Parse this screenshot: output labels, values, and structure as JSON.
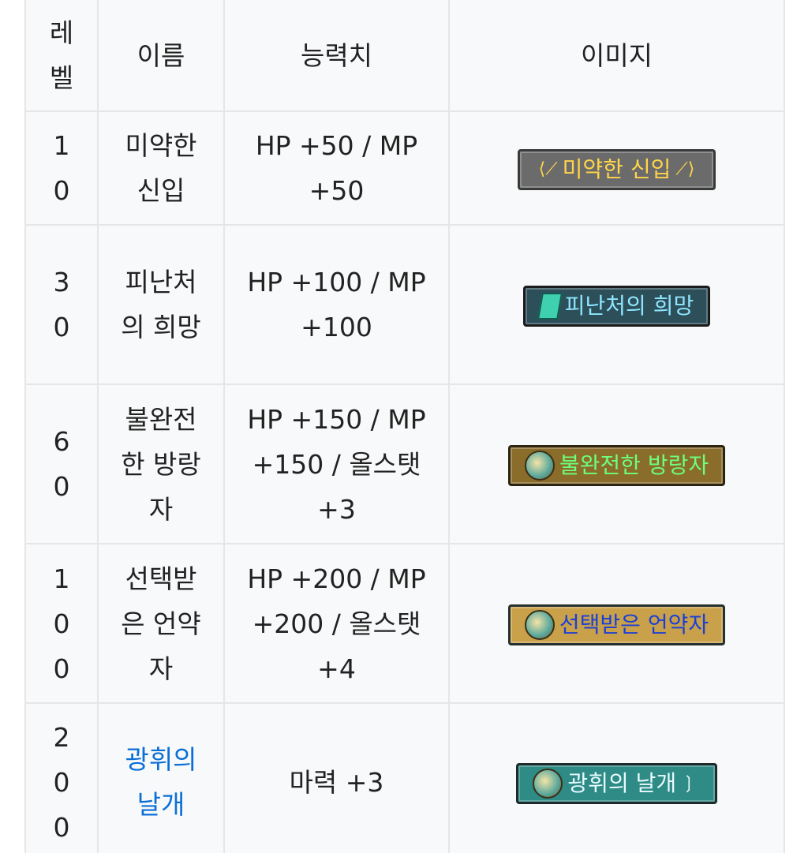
{
  "headers": {
    "level": "레벨",
    "name": "이름",
    "stats": "능력치",
    "image": "이미지"
  },
  "rows": [
    {
      "level": "10",
      "name": "미약한 신입",
      "stats": "HP +50 / MP +50",
      "badge_text": "미약한 신입"
    },
    {
      "level": "30",
      "name": "피난처의 희망",
      "stats": "HP +100 / MP +100",
      "badge_text": "피난처의 희망"
    },
    {
      "level": "60",
      "name": "불완전한 방랑자",
      "stats": "HP +150 / MP +150 / 올스탯 +3",
      "badge_text": "불완전한 방랑자"
    },
    {
      "level": "100",
      "name": "선택받은 언약자",
      "stats": "HP +200 / MP +200 / 올스탯 +4",
      "badge_text": "선택받은 언약자"
    },
    {
      "level": "200",
      "name": "광휘의 날개",
      "stats": "마력 +3",
      "badge_text": "광휘의 날개"
    }
  ],
  "colors": {
    "link": "#0b6fd6",
    "border": "#e6e6e6",
    "cell_bg": "#f8f9fa"
  }
}
